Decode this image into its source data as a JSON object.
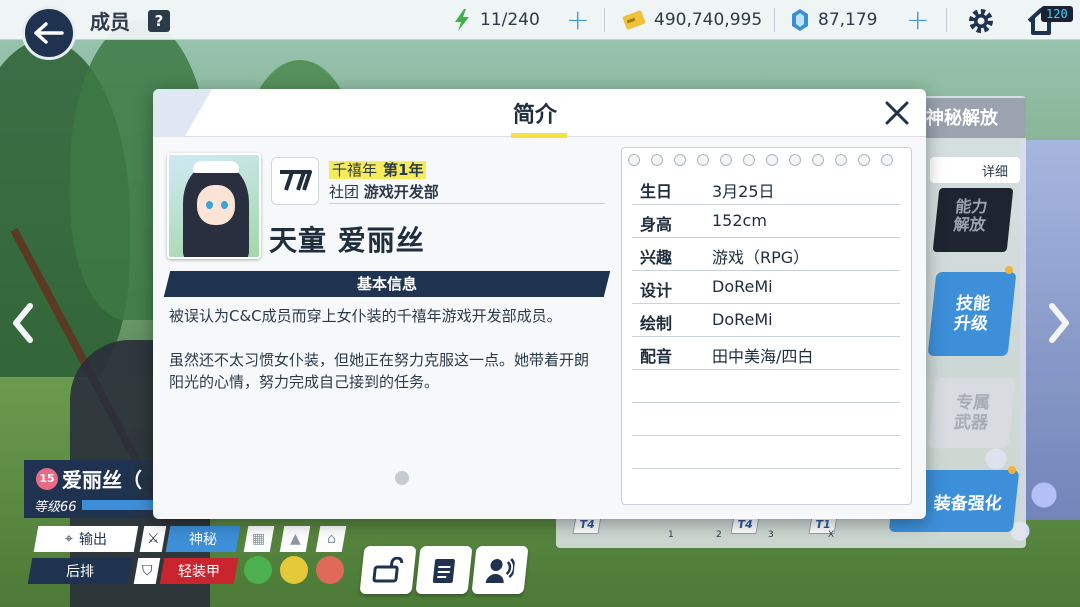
{
  "topbar": {
    "title": "成员",
    "help_icon": "?",
    "ap": "11/240",
    "credits": "490,740,995",
    "gems": "87,179",
    "fps": "120"
  },
  "icons": {
    "back": "back-arrow-icon",
    "ap": "lightning-icon",
    "credits": "credit-card-icon",
    "gems": "pyroxene-gem-icon",
    "settings": "gear-icon",
    "home": "home-icon",
    "close": "close-icon"
  },
  "colors": {
    "navy": "#1f3350",
    "accent_blue": "#3d8fd9",
    "highlight_yellow": "#f6ec5a",
    "plus_blue": "#3c9bd8"
  },
  "dialog": {
    "title": "简介",
    "school": "千禧年",
    "grade": "第1年",
    "club_label": "社团",
    "club": "游戏开发部",
    "character_name": "天童 爱丽丝",
    "section_label": "基本信息",
    "description": [
      "被误认为C&C成员而穿上女仆装的千禧年游戏开发部成员。",
      "虽然还不太习惯女仆装，但她正在努力克服这一点。她带着开朗阳光的心情，努力完成自己接到的任务。"
    ],
    "profile": [
      {
        "key": "生日",
        "value": "3月25日"
      },
      {
        "key": "身高",
        "value": "152cm"
      },
      {
        "key": "兴趣",
        "value": "游戏（RPG）"
      },
      {
        "key": "设计",
        "value": "DoReMi"
      },
      {
        "key": "绘制",
        "value": "DoReMi"
      },
      {
        "key": "配音",
        "value": "田中美海/四白"
      }
    ]
  },
  "background_panel": {
    "header": "神秘解放",
    "detail_button": "详细",
    "locked_card": "能力解放",
    "skill_button": "技能升级",
    "weapon_button": "专属武器",
    "equip_button": "装备强化",
    "tier_labels": [
      "T4",
      "T4",
      "T4",
      "T1"
    ],
    "tier_numbers": [
      "1",
      "2",
      "3",
      "X"
    ]
  },
  "student_plate": {
    "level_badge": "15",
    "name": "爱丽丝（",
    "level": "等级66",
    "attack_label": "输出",
    "attack_type": "神秘",
    "position": "后排",
    "armor_type": "轻装甲"
  }
}
